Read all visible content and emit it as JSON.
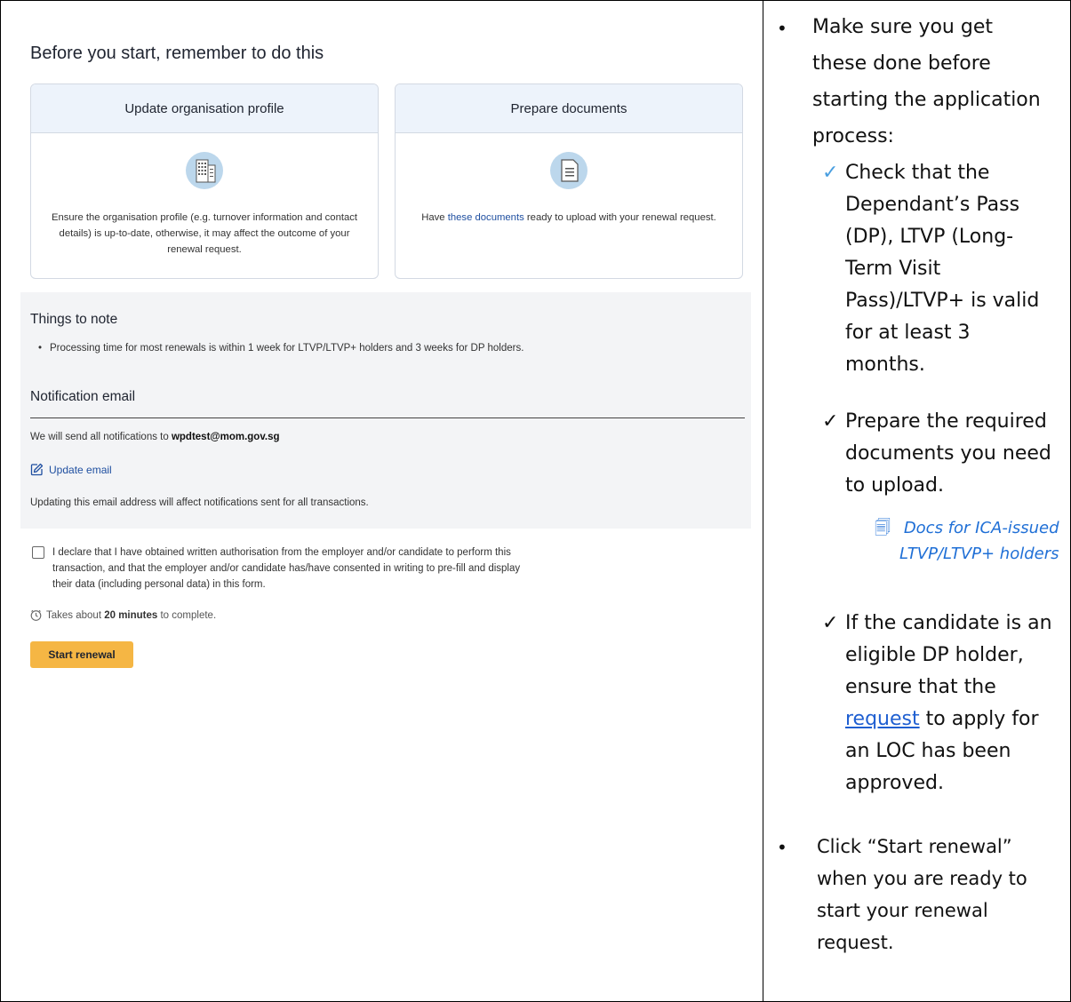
{
  "left": {
    "heading": "Before you start, remember to do this",
    "cards": [
      {
        "title": "Update organisation profile",
        "icon": "building-icon",
        "text": "Ensure the organisation profile (e.g. turnover information and contact details) is up-to-date, otherwise, it may affect the outcome of your renewal request."
      },
      {
        "title": "Prepare documents",
        "icon": "document-icon",
        "text_prefix": "Have ",
        "link": "these documents",
        "text_suffix": " ready to upload with your renewal request."
      }
    ],
    "notes": {
      "title": "Things to note",
      "items": [
        "Processing time for most renewals is within 1 week for LTVP/LTVP+ holders and 3 weeks for DP holders."
      ]
    },
    "email": {
      "title": "Notification email",
      "line_prefix": "We will send all notifications to ",
      "address": "wpdtest@mom.gov.sg",
      "update_label": "Update email",
      "update_note": "Updating this email address will affect notifications sent for all transactions."
    },
    "declaration": "I declare that I have obtained written authorisation from the employer and/or candidate to perform this transaction, and that the employer and/or candidate has/have consented in writing to pre-fill and display their data (including personal data) in this form.",
    "time": {
      "prefix": "Takes about ",
      "value": "20 minutes",
      "suffix": " to complete."
    },
    "start_button": "Start renewal"
  },
  "right": {
    "bullet1": [
      "Make sure you get",
      "these done before",
      "starting the application",
      "process:"
    ],
    "check1": [
      "Check that the",
      "Dependant’s Pass",
      "(DP), LTVP (Long-",
      "Term Visit",
      "Pass)/LTVP+ is valid",
      "for at least 3",
      "months."
    ],
    "check2": [
      "Prepare the required",
      "documents you need",
      "to upload."
    ],
    "doc_link": [
      "Docs for ICA-issued",
      "LTVP/LTVP+ holders"
    ],
    "check3_line1": "If the candidate is an",
    "check3_line2": "eligible DP holder,",
    "check3_line3": "ensure that the",
    "check3_link": "request",
    "check3_line4_suffix": " to apply for",
    "check3_line5": "an LOC has been",
    "check3_line6": "approved.",
    "bullet2": [
      "Click “Start renewal”",
      "when you are ready to",
      "start your renewal",
      "request."
    ],
    "bullet_glyph": "•",
    "check_glyph": "✓",
    "doc_glyph": "🗐"
  }
}
